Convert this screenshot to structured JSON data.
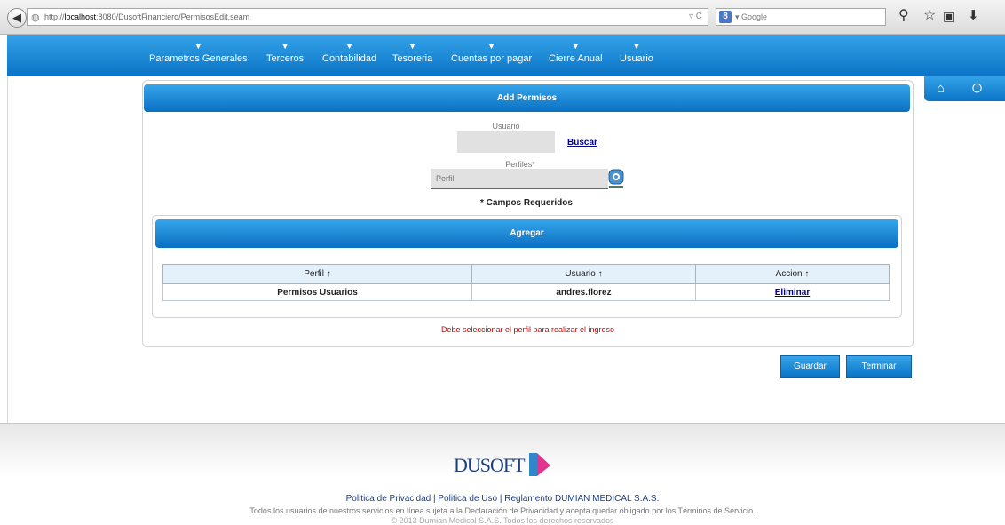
{
  "browser": {
    "url_host": "localhost",
    "url_prefix": "http://",
    "url_suffix": ":8080/DusoftFinanciero/PermisosEdit.seam",
    "search_placeholder": "Google",
    "search_engine_letter": "8"
  },
  "nav": {
    "items": [
      {
        "label": "Parametros Generales"
      },
      {
        "label": "Terceros"
      },
      {
        "label": "Contabilidad"
      },
      {
        "label": "Tesoreria"
      },
      {
        "label": "Cuentas por pagar"
      },
      {
        "label": "Cierre Anual"
      },
      {
        "label": "Usuario"
      }
    ]
  },
  "form": {
    "header": "Add Permisos",
    "usuario_label": "Usuario",
    "usuario_value": "",
    "buscar_link": "Buscar",
    "perfiles_label": "Perfiles*",
    "perfil_placeholder": "Perfil",
    "required_note": "* Campos Requeridos"
  },
  "agregar": {
    "header": "Agregar",
    "columns": [
      "Perfil ↑",
      "Usuario ↑",
      "Accion ↑"
    ],
    "rows": [
      {
        "perfil": "Permisos Usuarios",
        "usuario": "andres.florez",
        "accion": "Eliminar"
      }
    ]
  },
  "error_message": "Debe seleccionar el perfil para realizar el ingreso",
  "buttons": {
    "guardar": "Guardar",
    "terminar": "Terminar"
  },
  "footer": {
    "logo": "DUSOFT",
    "links": "Politica de Privacidad | Politica de Uso | Reglamento DUMIAN MEDICAL S.A.S.",
    "text": "Todos los usuarios de nuestros servicios en línea sujeta a la Declaración de Privacidad y acepta quedar obligado por los Términos de Servicio.",
    "copyright": "© 2013 Dumian Medical S.A.S. Todos los derechos reservados"
  },
  "colors": {
    "primary_blue": "#0b74c6",
    "error_red": "#d00000",
    "link_navy": "#00008b",
    "logo_navy": "#1d3f7f",
    "logo_pink": "#e2338e"
  }
}
